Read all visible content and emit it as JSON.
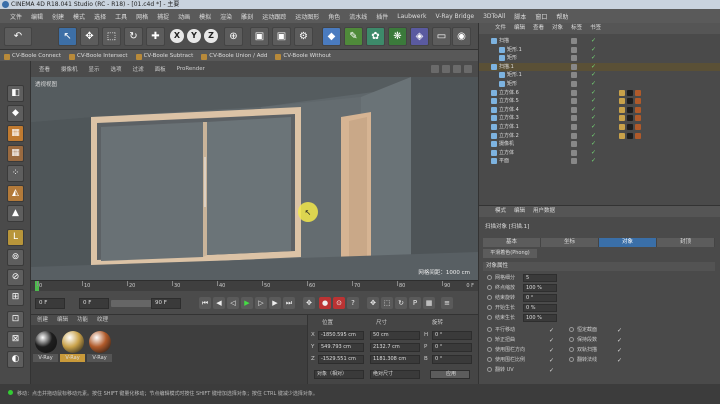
{
  "window": {
    "title": "CINEMA 4D R18.041 Studio (RC - R18) - [01.c4d *] - 主要"
  },
  "menu": [
    "文件",
    "编辑",
    "创建",
    "模式",
    "选择",
    "工具",
    "网格",
    "捕捉",
    "动画",
    "模拟",
    "渲染",
    "雕刻",
    "运动跟踪",
    "运动图形",
    "角色",
    "流水线",
    "插件",
    "Laubwerk",
    "V-Ray Bridge",
    "3DToAll",
    "脚本",
    "窗口",
    "帮助"
  ],
  "toolbar": {
    "axes": [
      "X",
      "Y",
      "Z"
    ]
  },
  "plugins": [
    "CV-Boole Connect",
    "CV-Boole Intersect",
    "CV-Boole Subtract",
    "CV-Boole Union / Add",
    "CV-Boole Without"
  ],
  "viewport": {
    "menu": [
      "查看",
      "摄像机",
      "显示",
      "选项",
      "过滤",
      "面板",
      "ProRender"
    ],
    "label": "透视视图",
    "grid": "网格间距：1000 cm"
  },
  "timeline": {
    "ticks": [
      "0",
      "10",
      "20",
      "30",
      "40",
      "50",
      "60",
      "70",
      "80",
      "90"
    ],
    "end": "0 F"
  },
  "transport": {
    "current": "0 F",
    "start": "0 F",
    "end": "90 F",
    "max": "90 F"
  },
  "materials": {
    "menu": [
      "创建",
      "编辑",
      "功能",
      "纹理"
    ],
    "items": [
      {
        "name": "V-Ray",
        "color": "#1e1e1e"
      },
      {
        "name": "V-Ray",
        "color": "#c9a24a"
      },
      {
        "name": "V-Ray",
        "color": "#b05a2a"
      }
    ]
  },
  "coords": {
    "headers": [
      "位置",
      "尺寸",
      "旋转"
    ],
    "rows": [
      {
        "axis": "X",
        "pos": "-1850.595 cm",
        "size": "50 cm",
        "rot_label": "H",
        "rot": "0 °"
      },
      {
        "axis": "Y",
        "pos": "549.793 cm",
        "size": "2132.7 cm",
        "rot_label": "P",
        "rot": "0 °"
      },
      {
        "axis": "Z",
        "pos": "-1529.551 cm",
        "size": "1181.308 cm",
        "rot_label": "B",
        "rot": "0 °"
      }
    ],
    "mode": "对象（相对）",
    "size_mode": "绝对尺寸",
    "apply": "应用"
  },
  "object_manager": {
    "tabs": [
      "文件",
      "编辑",
      "查看",
      "对象",
      "标签",
      "书签"
    ],
    "rows": [
      {
        "name": "扫描",
        "indent": 1,
        "selected": false
      },
      {
        "name": "矩形.1",
        "indent": 2,
        "selected": false
      },
      {
        "name": "矩形",
        "indent": 2,
        "selected": false
      },
      {
        "name": "扫描.1",
        "indent": 1,
        "selected": true
      },
      {
        "name": "矩形.1",
        "indent": 2,
        "selected": false
      },
      {
        "name": "矩形",
        "indent": 2,
        "selected": false
      },
      {
        "name": "立方体.6",
        "indent": 1,
        "selected": false
      },
      {
        "name": "立方体.5",
        "indent": 1,
        "selected": false
      },
      {
        "name": "立方体.4",
        "indent": 1,
        "selected": false
      },
      {
        "name": "立方体.3",
        "indent": 1,
        "selected": false
      },
      {
        "name": "立方体.1",
        "indent": 1,
        "selected": false
      },
      {
        "name": "立方体.2",
        "indent": 1,
        "selected": false
      },
      {
        "name": "摄像机",
        "indent": 1,
        "selected": false
      },
      {
        "name": "立方体",
        "indent": 1,
        "selected": false
      },
      {
        "name": "平面",
        "indent": 1,
        "selected": false
      }
    ]
  },
  "attributes": {
    "menu": [
      "模式",
      "编辑",
      "用户数据"
    ],
    "title": "扫描对象 [扫描.1]",
    "tabs": [
      "基本",
      "坐标",
      "对象",
      "封顶"
    ],
    "active_tab": "对象",
    "phong": "平滑着色(Phong)",
    "section": "对象属性",
    "props": [
      {
        "label": "网格细分",
        "value": "5"
      },
      {
        "label": "终点缩放",
        "value": "100 %"
      },
      {
        "label": "结束旋转",
        "value": "0 °"
      },
      {
        "label": "开始生长",
        "value": "0 %"
      },
      {
        "label": "结束生长",
        "value": "100 %"
      }
    ],
    "checks_left": [
      "平行移动",
      "矫正扭曲",
      "使用围栏方向",
      "使用围栏比例",
      "翻转 UV"
    ],
    "checks_right": [
      "恒定截面",
      "保持段数",
      "双轨扫描",
      "翻转法线"
    ]
  },
  "status": "移动：点击并拖动鼠标移动元素。按住 SHIFT 键量化移动；节点编辑模式时按住 SHIFT 键增加选择对象；按住 CTRL 键减少选择对象。"
}
